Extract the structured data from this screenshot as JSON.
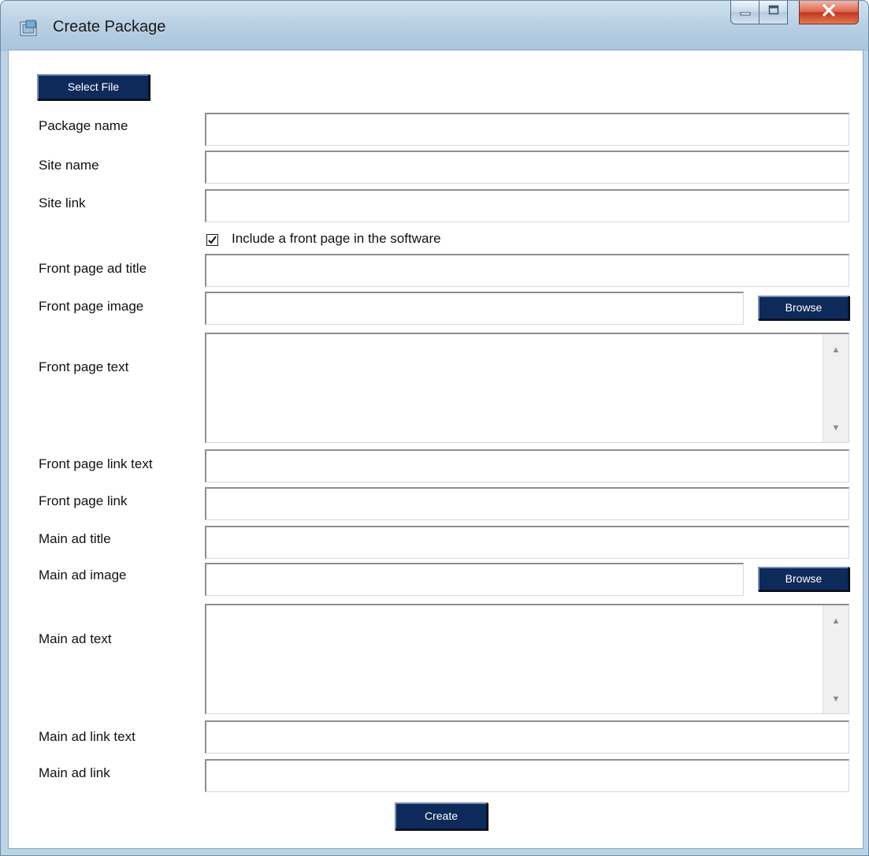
{
  "window": {
    "title": "Create Package"
  },
  "select_file": {
    "label": "Select File"
  },
  "fields": {
    "package_name": {
      "label": "Package name",
      "value": ""
    },
    "site_name": {
      "label": "Site name",
      "value": ""
    },
    "site_link": {
      "label": "Site link",
      "value": ""
    },
    "include_front_page": {
      "label": "Include a front page in the software",
      "checked": true
    },
    "front_ad_title": {
      "label": "Front page ad title",
      "value": ""
    },
    "front_image": {
      "label": "Front page image",
      "value": ""
    },
    "front_text": {
      "label": "Front page text",
      "value": ""
    },
    "front_link_text": {
      "label": "Front page link text",
      "value": ""
    },
    "front_link": {
      "label": "Front page link",
      "value": ""
    },
    "main_ad_title": {
      "label": "Main ad title",
      "value": ""
    },
    "main_image": {
      "label": "Main ad image",
      "value": ""
    },
    "main_text": {
      "label": "Main ad text",
      "value": ""
    },
    "main_link_text": {
      "label": "Main ad link text",
      "value": ""
    },
    "main_link": {
      "label": "Main ad link",
      "value": ""
    }
  },
  "browse": {
    "label": "Browse"
  },
  "create": {
    "label": "Create"
  },
  "icons": {
    "app": "package-icon",
    "min": "minimize-icon",
    "max": "maximize-icon",
    "close": "close-icon",
    "check": "checkmark-icon",
    "up": "scroll-up-icon",
    "down": "scroll-down-icon"
  },
  "colors": {
    "button_bg": "#0e2a5a",
    "button_text": "#ffffff",
    "close_red": "#c2321c",
    "frame": "#bcd3e6"
  }
}
